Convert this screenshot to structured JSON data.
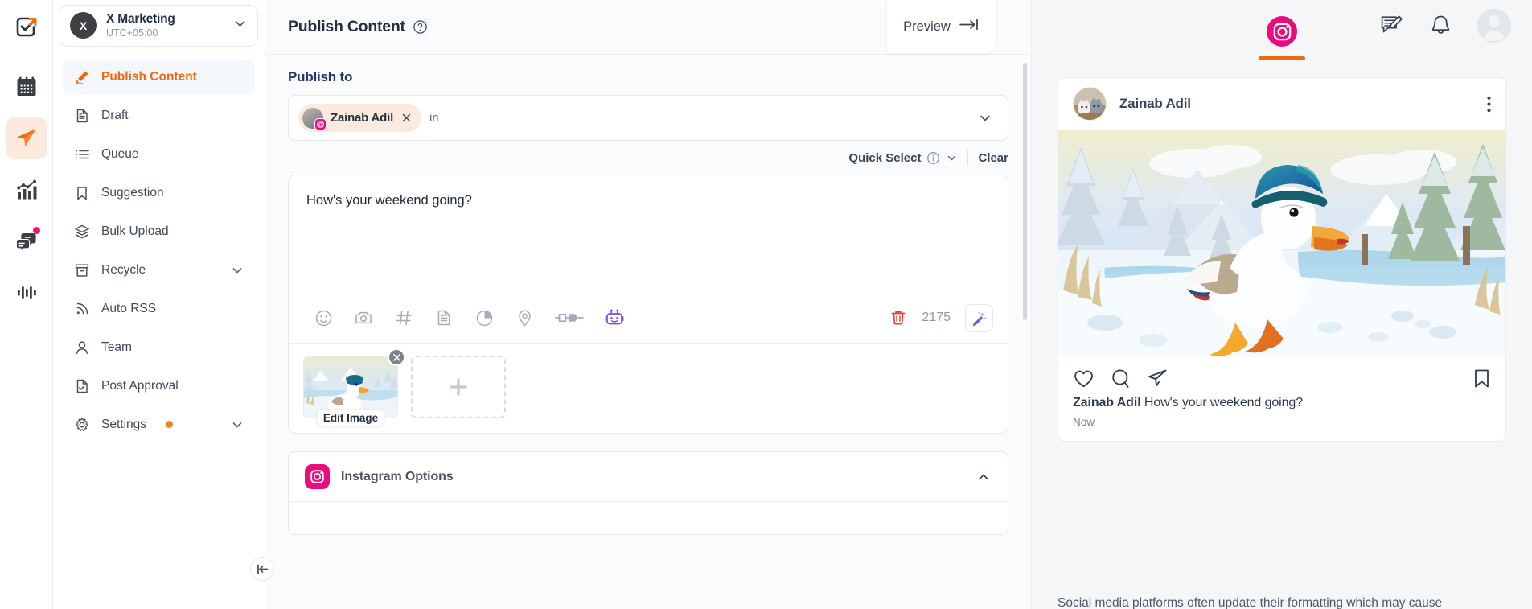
{
  "rail": {
    "items": [
      {
        "name": "logo",
        "icon": "checkbox-arrow-logo"
      },
      {
        "name": "calendar",
        "icon": "calendar-icon"
      },
      {
        "name": "publish",
        "icon": "paper-plane-icon",
        "active": true
      },
      {
        "name": "analytics",
        "icon": "bar-chart-icon"
      },
      {
        "name": "inbox",
        "icon": "chat-bubbles-icon",
        "badge": true
      },
      {
        "name": "activity",
        "icon": "audio-wave-icon"
      }
    ]
  },
  "org": {
    "initial": "X",
    "name": "X Marketing",
    "timezone": "UTC+05:00"
  },
  "sidebar": {
    "items": [
      {
        "label": "Publish Content",
        "icon": "pencil-icon",
        "active": true
      },
      {
        "label": "Draft",
        "icon": "document-icon"
      },
      {
        "label": "Queue",
        "icon": "list-icon"
      },
      {
        "label": "Suggestion",
        "icon": "bookmark-icon"
      },
      {
        "label": "Bulk Upload",
        "icon": "layers-icon"
      },
      {
        "label": "Recycle",
        "icon": "archive-icon",
        "caret": true
      },
      {
        "label": "Auto RSS",
        "icon": "rss-icon"
      },
      {
        "label": "Team",
        "icon": "person-icon"
      },
      {
        "label": "Post Approval",
        "icon": "document-check-icon"
      },
      {
        "label": "Settings",
        "icon": "gear-icon",
        "dot": true,
        "caret": true
      }
    ]
  },
  "header": {
    "title": "Publish Content",
    "icons": [
      "compose-icon",
      "bell-icon",
      "avatar"
    ]
  },
  "publish": {
    "section_label": "Publish to",
    "chip": {
      "name": "Zainab Adil",
      "network": "instagram"
    },
    "in_word": "in",
    "quick_select": "Quick Select",
    "clear": "Clear"
  },
  "editor": {
    "content": "How's your weekend going?",
    "char_count": "2175",
    "toolbar_icons": [
      "emoji-icon",
      "camera-icon",
      "hashtag-icon",
      "template-icon",
      "poll-icon",
      "location-icon",
      "plug-icon",
      "ai-bot-icon"
    ],
    "trash": "delete-icon",
    "magic": "ai-wand-icon",
    "edit_image_label": "Edit Image",
    "add_media_label": "+"
  },
  "options": {
    "title": "Instagram Options",
    "expanded": true
  },
  "preview": {
    "button_label": "Preview",
    "tab_network": "instagram",
    "post": {
      "author": "Zainab Adil",
      "caption": "How's your weekend going?",
      "time": "Now",
      "actions": [
        "like-icon",
        "comment-icon",
        "share-icon",
        "save-icon"
      ]
    },
    "note": "Social media platforms often update their formatting which may cause"
  },
  "colors": {
    "accent": "#f2690d",
    "instagram": "#ec0b7f",
    "title_blue": "#27346b",
    "danger": "#ef4136"
  }
}
